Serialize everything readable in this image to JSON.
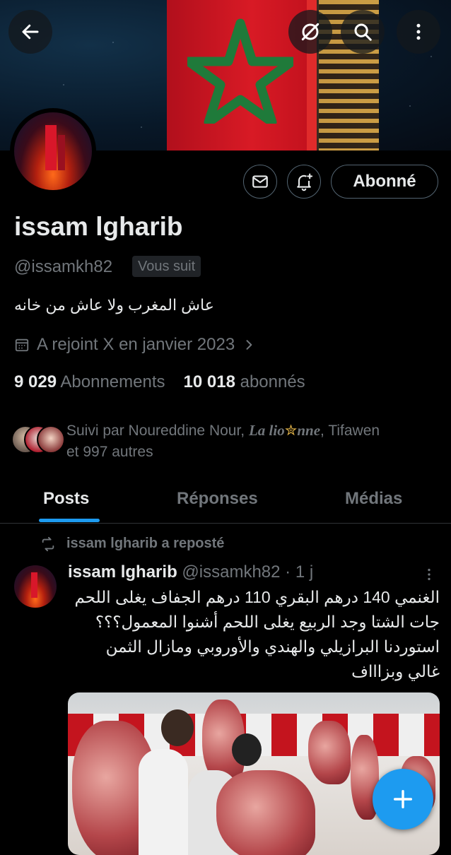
{
  "header": {
    "back_icon": "arrow-left-icon",
    "grok_icon": "slash-circle-icon",
    "search_icon": "search-icon",
    "more_icon": "more-vertical-icon"
  },
  "profile": {
    "name": "issam lgharib",
    "handle": "@issamkh82",
    "follows_you": "Vous suit",
    "bio": "عاش المغرب ولا عاش من خانه",
    "joined": "A rejoint X en janvier 2023",
    "following_count": "9 029",
    "following_label": "Abonnements",
    "followers_count": "10 018",
    "followers_label": "abonnés",
    "follow_button": "Abonné",
    "followed_by_prefix": "Suivi par Noureddine Nour, ",
    "followed_by_italic_a": "La lio",
    "followed_by_italic_b": "nne",
    "followed_by_suffix": ", Tifawen",
    "followed_by_line2": "et 997 autres"
  },
  "tabs": [
    {
      "label": "Posts",
      "active": true
    },
    {
      "label": "Réponses",
      "active": false
    },
    {
      "label": "Médias",
      "active": false
    }
  ],
  "post": {
    "repost_label": "issam lgharib a reposté",
    "author": "issam lgharib",
    "handle": "@issamkh82",
    "time": "· 1 j",
    "text_line1": "الغنمي 140 درهم البقري 110 درهم الجفاف يغلى اللحم",
    "text_line2": "جات الشتا وجد الربيع يغلى اللحم أشنوا المعمول؟؟؟",
    "text_line3": "استوردنا البرازيلي والهندي والأوروبي ومازال الثمن",
    "text_line4": "غالي وبزاااف"
  },
  "colors": {
    "accent": "#1d9bf0",
    "background": "#000000",
    "text_primary": "#e7e9ea",
    "text_secondary": "#71767b"
  }
}
